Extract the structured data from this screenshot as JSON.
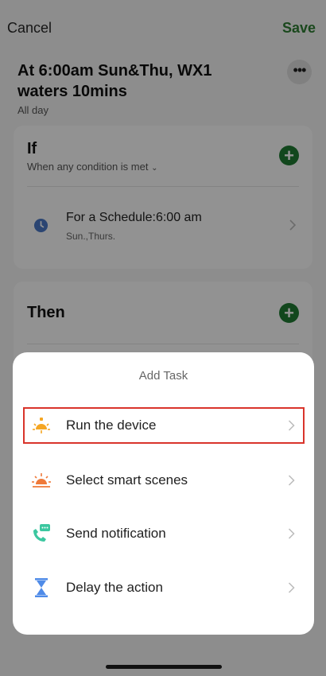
{
  "header": {
    "cancel_label": "Cancel",
    "save_label": "Save",
    "automation_title": "At 6:00am Sun&Thu, WX1 waters 10mins",
    "time_range": "All day",
    "more_icon": "more-horizontal-icon"
  },
  "if_section": {
    "heading": "If",
    "condition_mode": "When any condition is met",
    "add_icon": "plus-icon",
    "conditions": [
      {
        "icon": "clock-icon",
        "title": "For a Schedule:6:00 am",
        "subtitle": "Sun.,Thurs."
      }
    ]
  },
  "then_section": {
    "heading": "Then",
    "add_icon": "plus-icon"
  },
  "add_task_sheet": {
    "title": "Add Task",
    "options": [
      {
        "label": "Run the device",
        "icon": "device-bulb-icon",
        "highlighted": true
      },
      {
        "label": "Select smart scenes",
        "icon": "sunrise-scene-icon",
        "highlighted": false
      },
      {
        "label": "Send notification",
        "icon": "phone-message-icon",
        "highlighted": false
      },
      {
        "label": "Delay the action",
        "icon": "hourglass-icon",
        "highlighted": false
      }
    ]
  },
  "colors": {
    "accent_green": "#2e7d32",
    "add_button_green": "#1f7a33",
    "highlight_red": "#d9342b",
    "clock_blue": "#4a78c4",
    "bulb_orange": "#f5a623",
    "scene_orange": "#ef7a3a",
    "notification_teal": "#3cc7a0",
    "hourglass_blue": "#4f8be8"
  }
}
